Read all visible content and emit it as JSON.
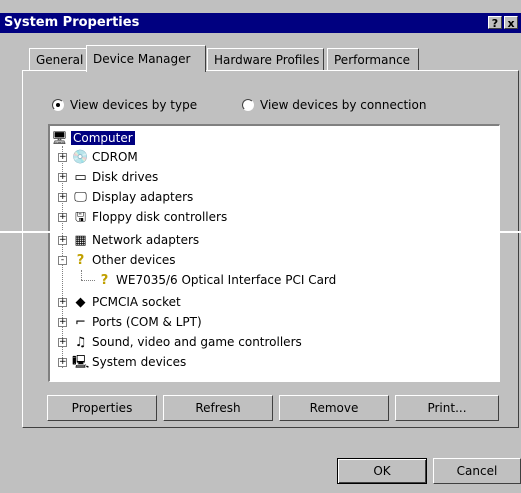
{
  "window": {
    "title": "System Properties",
    "help_glyph": "?",
    "close_glyph": "x"
  },
  "tabs": [
    {
      "label": "General"
    },
    {
      "label": "Device Manager"
    },
    {
      "label": "Hardware Profiles"
    },
    {
      "label": "Performance"
    }
  ],
  "view": {
    "by_type": "View devices by type",
    "by_connection": "View devices by connection",
    "selected": "by_type"
  },
  "tree": {
    "root": "Computer",
    "items": [
      {
        "label": "CDROM",
        "icon": "cdrom-icon",
        "expander": "+"
      },
      {
        "label": "Disk drives",
        "icon": "disk-drive-icon",
        "expander": "+"
      },
      {
        "label": "Display adapters",
        "icon": "monitor-icon",
        "expander": "+"
      },
      {
        "label": "Floppy disk controllers",
        "icon": "floppy-icon",
        "expander": "+"
      },
      {
        "label": "Network adapters",
        "icon": "network-icon",
        "expander": "+"
      },
      {
        "label": "Other devices",
        "icon": "question-icon",
        "expander": "-"
      },
      {
        "label": "WE7035/6 Optical Interface PCI Card",
        "icon": "question-icon",
        "expander": ""
      },
      {
        "label": "PCMCIA socket",
        "icon": "pcmcia-icon",
        "expander": "+"
      },
      {
        "label": "Ports (COM & LPT)",
        "icon": "port-icon",
        "expander": "+"
      },
      {
        "label": "Sound, video and game controllers",
        "icon": "sound-icon",
        "expander": "+"
      },
      {
        "label": "System devices",
        "icon": "system-icon",
        "expander": "+"
      }
    ]
  },
  "buttons": {
    "properties": "Properties",
    "refresh": "Refresh",
    "remove": "Remove",
    "print": "Print...",
    "ok": "OK",
    "cancel": "Cancel"
  },
  "colors": {
    "titlebar": "#000080",
    "face": "#c0c0c0",
    "selection": "#000080"
  }
}
